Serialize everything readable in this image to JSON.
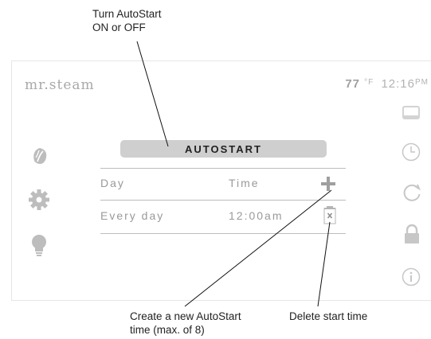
{
  "callouts": {
    "autostart_line1": "Turn AutoStart",
    "autostart_line2": "ON or OFF",
    "create_line1": "Create a new AutoStart",
    "create_line2": "time (max. of 8)",
    "delete": "Delete start time"
  },
  "header": {
    "brand_part1": "mr",
    "brand_dot": ".",
    "brand_part2": "steam",
    "temperature": "77",
    "temp_unit": "°F",
    "time": "12:16",
    "ampm": "PM"
  },
  "autostart": {
    "button_label": "AUTOSTART",
    "columns": {
      "day": "Day",
      "time": "Time"
    },
    "rows": [
      {
        "day": "Every day",
        "time": "12:00am"
      }
    ]
  },
  "icons": {
    "left": [
      "leaf-icon",
      "gear-icon",
      "lightbulb-icon"
    ],
    "right": [
      "display-icon",
      "clock-icon",
      "refresh-icon",
      "lock-icon",
      "info-icon"
    ],
    "actions": [
      "plus-icon",
      "trash-icon"
    ]
  },
  "colors": {
    "icon_gray": "#bdbdbd",
    "button_bg": "#cfcfcf",
    "text_gray": "#9a9a9a"
  }
}
